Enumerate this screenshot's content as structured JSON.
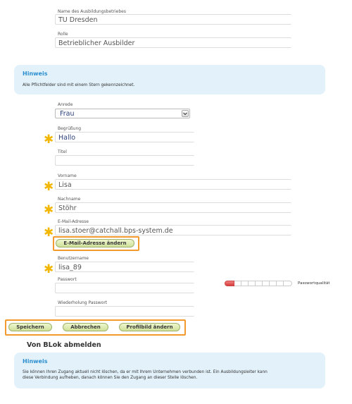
{
  "company": {
    "label": "Name des Ausbildungsbetriebes",
    "value": "TU Dresden"
  },
  "role": {
    "label": "Rolle",
    "value": "Betrieblicher Ausbilder"
  },
  "hint1": {
    "title": "Hinweis",
    "text": "Alle Pflichtfelder sind mit einem Stern gekennzeichnet."
  },
  "salutation": {
    "label": "Anrede",
    "value": "Frau"
  },
  "greeting": {
    "label": "Begrüßung",
    "value": "Hallo"
  },
  "title_field": {
    "label": "Titel",
    "value": ""
  },
  "firstname": {
    "label": "Vorname",
    "value": "Lisa"
  },
  "lastname": {
    "label": "Nachname",
    "value": "Stöhr"
  },
  "email": {
    "label": "E-Mail-Adresse",
    "value": "lisa.stoer@catchall.bps-system.de",
    "change_button": "E-Mail-Adresse ändern"
  },
  "username": {
    "label": "Benutzername",
    "value": "lisa_89"
  },
  "password": {
    "label": "Passwort",
    "value": "",
    "quality_label": "Passwortqualität",
    "quality_level": 0.15
  },
  "password_repeat": {
    "label": "Wiederholung Passwort",
    "value": ""
  },
  "actions": {
    "save": "Speichern",
    "cancel": "Abbrechen",
    "profile_picture": "Profilbild ändern"
  },
  "unsubscribe": {
    "heading": "Von BLok abmelden"
  },
  "hint2": {
    "title": "Hinweis",
    "line1": "Sie können Ihren Zugang aktuell nicht löschen, da er mit Ihrem Unternehmen verbunden ist. Ein Ausbildungsleiter kann",
    "line2": "diese Verbindung aufheben, danach können Sie den Zugang an dieser Stelle löschen."
  },
  "colors": {
    "star": "#f2b705",
    "highlight": "#f29a2e",
    "hint_bg": "#e2f1fa",
    "hint_title": "#2b8fd0",
    "button_green": "#cfe19a"
  },
  "icons": {
    "required": "star-icon",
    "dropdown": "chevron-down-icon"
  }
}
